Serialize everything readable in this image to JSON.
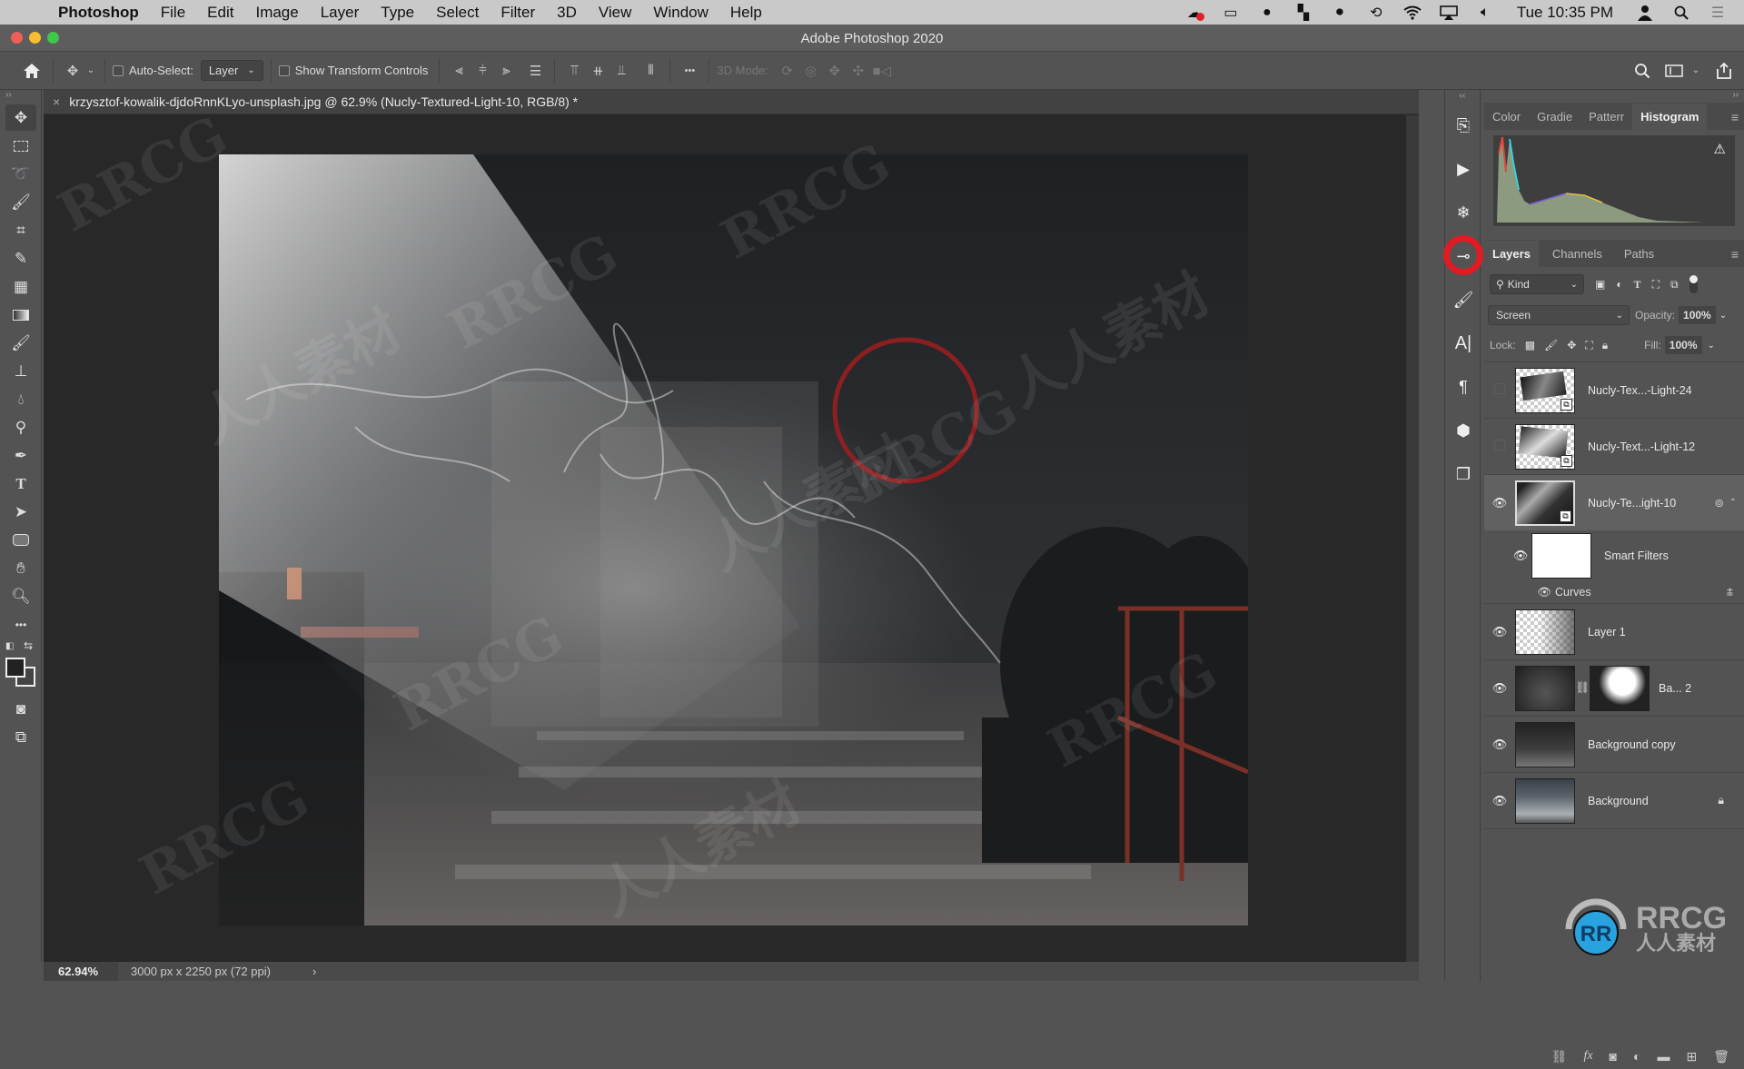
{
  "menubar": {
    "app_name": "Photoshop",
    "items": [
      "File",
      "Edit",
      "Image",
      "Layer",
      "Type",
      "Select",
      "Filter",
      "3D",
      "View",
      "Window",
      "Help"
    ],
    "clock": "Tue 10:35 PM"
  },
  "window": {
    "title": "Adobe Photoshop 2020"
  },
  "options_bar": {
    "auto_select_label": "Auto-Select:",
    "auto_select_target": "Layer",
    "show_transform_label": "Show Transform Controls",
    "more_label": "•••",
    "mode_3d_label": "3D Mode:"
  },
  "document": {
    "tab_title": "krzysztof-kowalik-djdoRnnKLyo-unsplash.jpg @ 62.9% (Nucly-Textured-Light-10, RGB/8) *"
  },
  "status_bar": {
    "zoom": "62.94%",
    "doc_info": "3000 px x 2250 px (72 ppi)",
    "arrow": "›"
  },
  "top_panel": {
    "tabs": [
      {
        "label": "Color",
        "active": false
      },
      {
        "label": "Gradie",
        "active": false
      },
      {
        "label": "Patterr",
        "active": false
      },
      {
        "label": "Histogram",
        "active": true
      }
    ],
    "warning_icon": "⚠"
  },
  "layers_panel": {
    "tabs": [
      {
        "label": "Layers",
        "active": true
      },
      {
        "label": "Channels",
        "active": false
      },
      {
        "label": "Paths",
        "active": false
      }
    ],
    "filter_kind": "Kind",
    "blend_mode": "Screen",
    "opacity_label": "Opacity:",
    "opacity_value": "100%",
    "lock_label": "Lock:",
    "fill_label": "Fill:",
    "fill_value": "100%",
    "layers": [
      {
        "name": "Nucly-Tex...-Light-24",
        "visible": false,
        "type": "smart-object"
      },
      {
        "name": "Nucly-Text...-Light-12",
        "visible": false,
        "type": "smart-object"
      },
      {
        "name": "Nucly-Te...ight-10",
        "visible": true,
        "type": "smart-object",
        "selected": true
      },
      {
        "name": "Smart Filters",
        "visible": true,
        "type": "smart-filters"
      },
      {
        "name": "Curves",
        "visible": true,
        "type": "filter"
      },
      {
        "name": "Layer 1",
        "visible": true,
        "type": "pixel"
      },
      {
        "name": "Ba... 2",
        "visible": true,
        "type": "masked"
      },
      {
        "name": "Background copy",
        "visible": true,
        "type": "pixel"
      },
      {
        "name": "Background",
        "visible": true,
        "type": "background",
        "locked": true
      }
    ]
  },
  "watermark": {
    "brand": "RRCG",
    "brand_cn": "人人素材"
  }
}
